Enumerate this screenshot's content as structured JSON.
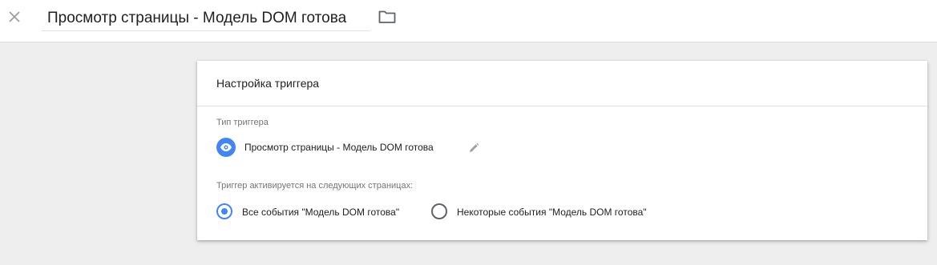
{
  "header": {
    "title": "Просмотр страницы - Модель DOM готова"
  },
  "card": {
    "title": "Настройка триггера",
    "trigger_type_label": "Тип триггера",
    "trigger_type_value": "Просмотр страницы - Модель DOM готова",
    "fires_on_label": "Триггер активируется на следующих страницах:",
    "options": [
      {
        "label": "Все события \"Модель DOM готова\"",
        "selected": true
      },
      {
        "label": "Некоторые события \"Модель DOM готова\"",
        "selected": false
      }
    ]
  },
  "colors": {
    "accent": "#4285f4",
    "background": "#eeeeee"
  },
  "icons": {
    "close": "close-icon",
    "folder": "folder-icon",
    "eye": "eye-icon",
    "edit": "pencil-icon"
  }
}
